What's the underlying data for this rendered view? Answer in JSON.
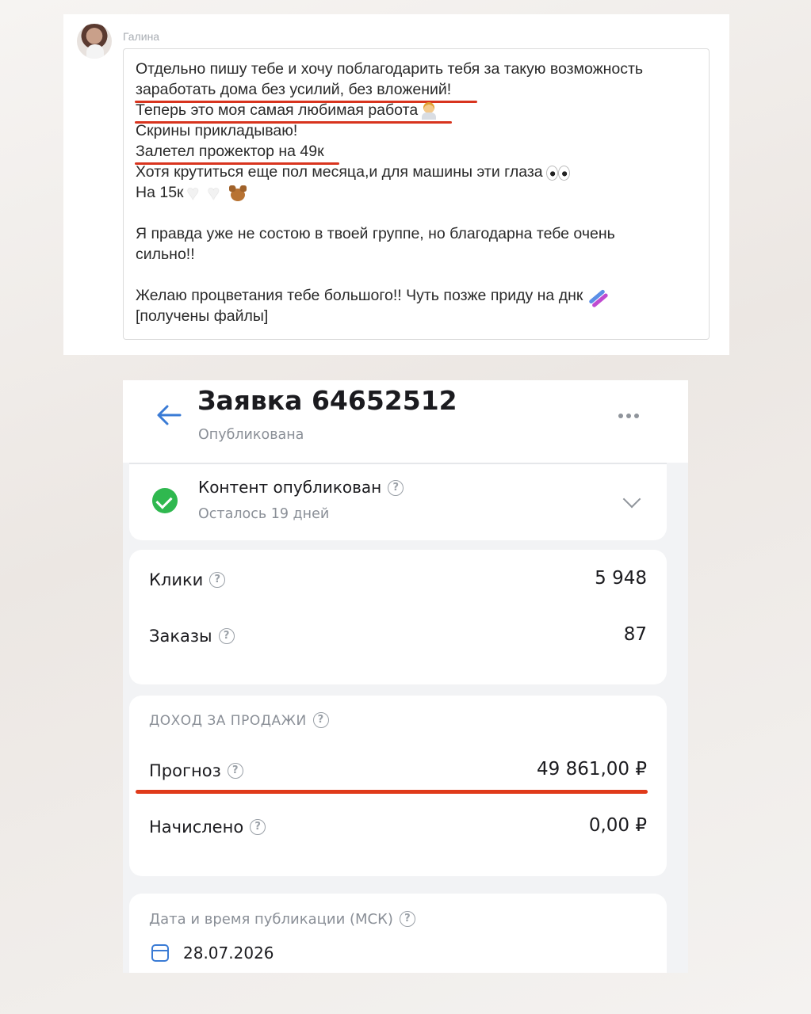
{
  "chat": {
    "sender": "Галина",
    "lines": [
      "Отдельно пишу тебе и хочу поблагодарить тебя за такую возможность",
      "заработать дома без усилий, без вложений!",
      "Теперь это моя самая любимая работа",
      "Скрины прикладываю!",
      "Залетел прожектор на 49к",
      "Хотя крутиться еще пол месяца,и для машины эти глаза",
      "На 15к",
      "Я правда уже не состою в твоей группе, но благодарна тебе очень",
      "сильно!!",
      "Желаю процветания тебе большого!! Чуть позже приду на днк",
      "[получены файлы]"
    ],
    "emoji": [
      "worker",
      "eyes",
      "white-heart",
      "white-heart",
      "teddy-bear",
      "dna"
    ],
    "underline_color": "#d8341e"
  },
  "app": {
    "header": {
      "title": "Заявка 64652512",
      "subtitle": "Опубликована",
      "back_icon": "arrow-left-icon",
      "more_icon": "more-horizontal-icon"
    },
    "status": {
      "title": "Контент опубликован",
      "subtitle": "Осталось 19 дней",
      "icon": "check-circle-icon",
      "icon_color": "#2fb84f"
    },
    "metrics": [
      {
        "label": "Клики",
        "value": "5 948"
      },
      {
        "label": "Заказы",
        "value": "87"
      }
    ],
    "income": {
      "caption": "ДОХОД ЗА ПРОДАЖИ",
      "rows": [
        {
          "label": "Прогноз",
          "value": "49 861,00 ₽"
        },
        {
          "label": "Начислено",
          "value": "0,00 ₽"
        }
      ],
      "highlight_color": "#e03a1a"
    },
    "publication": {
      "caption": "Дата и время публикации (МСК)",
      "date": "28.07.2026",
      "icon": "calendar-icon"
    },
    "help_glyph": "?",
    "accent_color": "#3a7bd5"
  }
}
